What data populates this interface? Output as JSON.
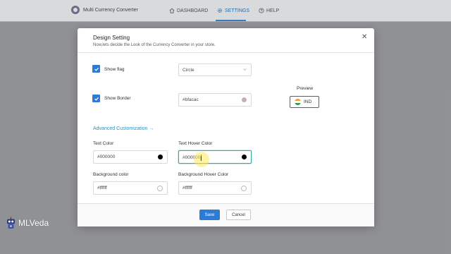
{
  "app": {
    "name": "Multi Currency Converter",
    "nav": [
      {
        "label": "DASHBOARD",
        "icon": "home-icon"
      },
      {
        "label": "SETTINGS",
        "icon": "gear-icon",
        "active": true
      },
      {
        "label": "HELP",
        "icon": "help-circle-icon"
      }
    ]
  },
  "modal": {
    "title": "Design Setting",
    "subtitle": "Now,lets decide the Look of the Currency Converter in your store.",
    "show_flag": {
      "label": "Show flag",
      "checked": true
    },
    "flag_shape": {
      "value": "Circle"
    },
    "show_border": {
      "label": "Show Border",
      "checked": true
    },
    "border_color": {
      "value": "#bfacac",
      "swatch": "#c4b0b0"
    },
    "preview": {
      "title": "Preview",
      "currency": "IND"
    },
    "advanced_link": "Advanced Customization →",
    "text_color": {
      "label": "Text Color",
      "value": "#000000",
      "swatch": "#000000"
    },
    "text_hover_color": {
      "label": "Text Hover Color",
      "value": "#000000",
      "swatch": "#000000"
    },
    "background_color": {
      "label": "Background color",
      "value": "#ffffff",
      "swatch": "#ffffff"
    },
    "background_hover_color": {
      "label": "Background Hover Color",
      "value": "#ffffff",
      "swatch": "#ffffff"
    },
    "save_label": "Save",
    "cancel_label": "Cancel"
  },
  "watermark": {
    "text": "MLVeda"
  },
  "colors": {
    "accent": "#2e7bd6",
    "link": "#2b8fc3",
    "focus": "#3aa7a3"
  }
}
